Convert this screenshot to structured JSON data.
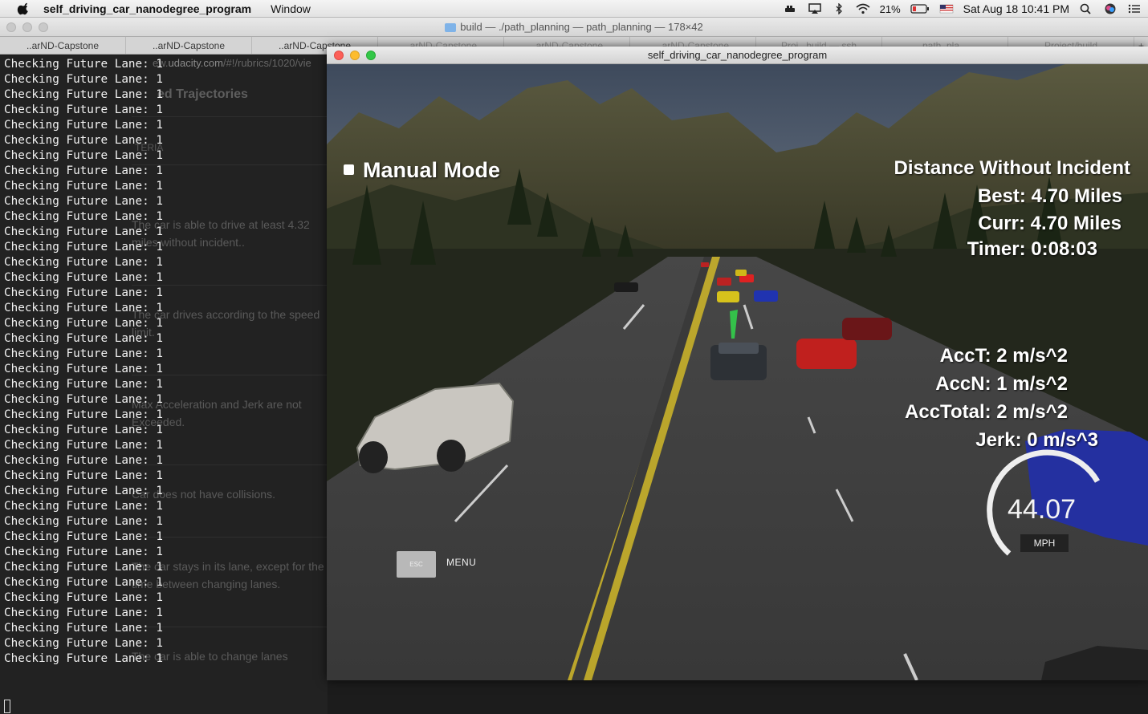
{
  "menubar": {
    "app_name": "self_driving_car_nanodegree_program",
    "menu_window": "Window",
    "battery": "21%",
    "datetime": "Sat Aug 18  10:41 PM"
  },
  "terminal": {
    "title": "build — ./path_planning — path_planning — 178×42",
    "tabs": [
      "..arND-Capstone",
      "..arND-Capstone",
      "..arND-Capstone",
      "..arND-Capstone",
      "..arND-Capstone",
      "..arND-Capstone",
      "Proj...build — ssh",
      "path_pla...",
      "Project/build"
    ],
    "line_text": "Checking Future Lane: 1",
    "line_count": 40
  },
  "background_page": {
    "url_prefix": "ew.",
    "url_domain": "udacity.com",
    "url_path": "/#!/rubrics/1020/vie",
    "heading": "ed Trajectories",
    "criteria_label": "TERIA",
    "items": [
      "The car is able to drive at least 4.32 miles without incident..",
      "The car drives according to the speed limit.",
      "Max Acceleration and Jerk are not Exceeded.",
      "Car does not have collisions.",
      "The car stays in its lane, except for the time between changing lanes.",
      "The car is able to change lanes"
    ]
  },
  "simulator": {
    "title": "self_driving_car_nanodegree_program",
    "mode": "Manual Mode",
    "distance_title": "Distance Without Incident",
    "best": "Best: 4.70 Miles",
    "curr": "Curr: 4.70 Miles",
    "timer": "Timer: 0:08:03",
    "acc_t": "AccT: 2 m/s^2",
    "acc_n": "AccN: 1 m/s^2",
    "acc_total": "AccTotal: 2 m/s^2",
    "jerk": "Jerk: 0 m/s^3",
    "speed": "44.07",
    "speed_unit": "MPH",
    "esc_key": "ESC",
    "menu_label": "MENU"
  },
  "colors": {
    "sky": "#4c5a6e",
    "road": "#3e3e3e",
    "center_line": "#c9b12a",
    "hud_text": "#ffffff"
  }
}
